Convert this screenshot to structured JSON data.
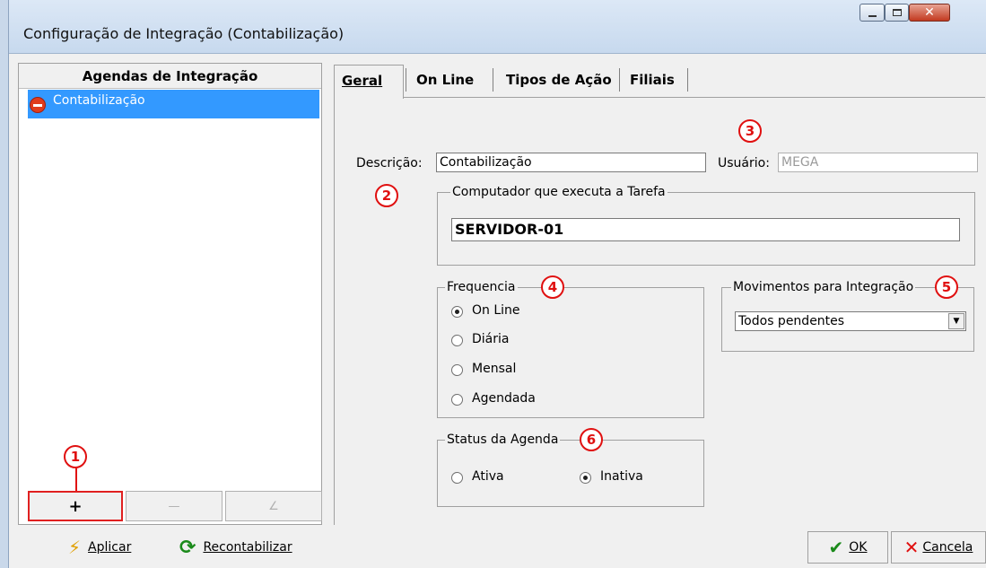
{
  "window": {
    "title": "Configuração de Integração (Contabilização)"
  },
  "left_panel": {
    "header": "Agendas de Integração",
    "items": [
      {
        "label": "Contabilização",
        "icon": "stop-icon",
        "selected": true
      }
    ],
    "buttons": {
      "add": "+",
      "remove": "—",
      "edit": "∠"
    }
  },
  "tabs": [
    {
      "label": "Geral",
      "active": true
    },
    {
      "label": "On Line"
    },
    {
      "label": "Tipos de Ação"
    },
    {
      "label": "Filiais"
    }
  ],
  "form": {
    "descricao_label": "Descrição:",
    "descricao_value": "Contabilização",
    "usuario_label": "Usuário:",
    "usuario_value": "MEGA",
    "computador_group": "Computador que executa a Tarefa",
    "computador_value": "SERVIDOR-01",
    "frequencia_group": "Frequencia",
    "frequencia_options": [
      "On Line",
      "Diária",
      "Mensal",
      "Agendada"
    ],
    "frequencia_selected": "On Line",
    "movimentos_group": "Movimentos para Integração",
    "movimentos_value": "Todos pendentes",
    "status_group": "Status da Agenda",
    "status_options": [
      "Ativa",
      "Inativa"
    ],
    "status_selected": "Inativa"
  },
  "callouts": [
    "1",
    "2",
    "3",
    "4",
    "5",
    "6"
  ],
  "bottom": {
    "aplicar": "Aplicar",
    "recontabilizar": "Recontabilizar",
    "ok": "OK",
    "cancela": "Cancela"
  },
  "colors": {
    "selection": "#3399ff",
    "callout": "#e01010"
  }
}
